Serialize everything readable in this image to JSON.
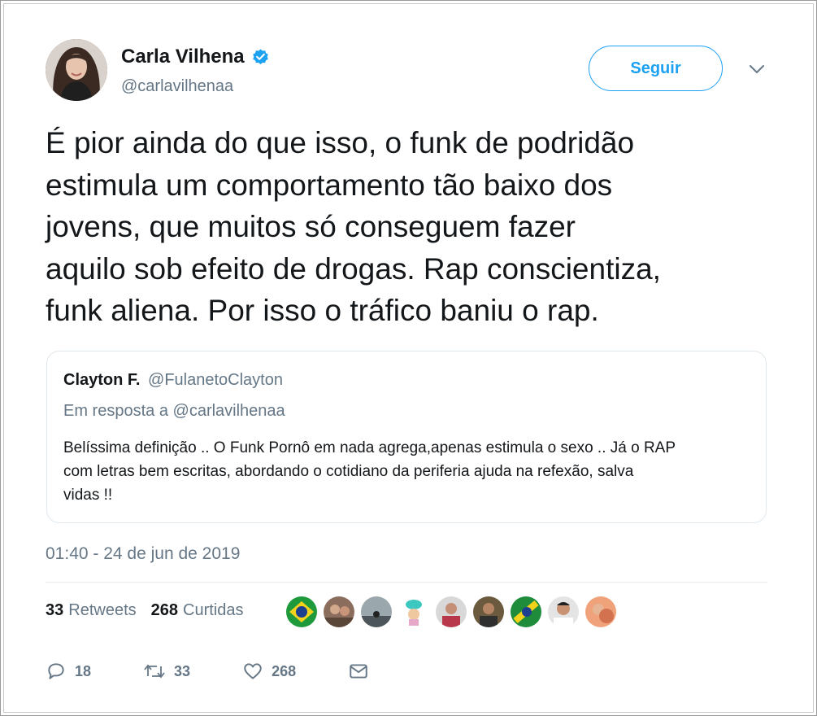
{
  "author": {
    "name": "Carla Vilhena",
    "handle": "@carlavilhenaa",
    "verified_color": "#1da1f2"
  },
  "follow_button": {
    "label": "Seguir"
  },
  "menu": {
    "icon": "chevron-down-icon"
  },
  "tweet": {
    "lines": [
      "É pior ainda do que isso, o funk de podridão",
      "estimula um comportamento tão baixo dos",
      "jovens, que muitos só conseguem fazer",
      "aquilo sob efeito de drogas. Rap conscientiza,",
      "funk aliena. Por isso o tráfico baniu o rap."
    ]
  },
  "quoted": {
    "name": "Clayton F.",
    "handle": "@FulanetoClayton",
    "reply_prefix": "Em resposta a",
    "reply_to": "@carlavilhenaa",
    "lines": [
      "Belíssima definição .. O Funk Pornô em nada agrega,apenas estimula o sexo .. Já o RAP",
      "com letras bem escritas, abordando o cotidiano da periferia ajuda na refexão, salva",
      "vidas !!"
    ]
  },
  "timestamp": "01:40 - 24 de jun de 2019",
  "stats": {
    "retweets_count": "33",
    "retweets_label": "Retweets",
    "likes_count": "268",
    "likes_label": "Curtidas"
  },
  "actions": {
    "replies": "18",
    "retweets": "33",
    "likes": "268"
  },
  "colors": {
    "accent": "#1da1f2",
    "secondary_text": "#657786",
    "primary_text": "#14171a",
    "border": "#e1e8ed"
  }
}
